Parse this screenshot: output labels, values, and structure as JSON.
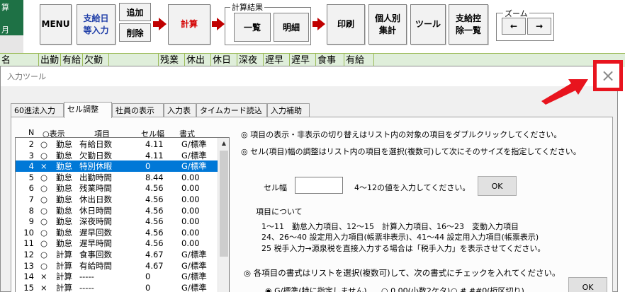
{
  "sheet": {
    "green_tab": [
      "算",
      "",
      "月"
    ],
    "header_cells": [
      "名",
      "出勤",
      "有給",
      "欠勤",
      "",
      "残業",
      "休出",
      "休日",
      "深夜",
      "遅早",
      "遅早",
      "食事",
      "有給"
    ]
  },
  "toolbar": {
    "menu": "MENU",
    "pay_input_l1": "支給日",
    "pay_input_l2": "等入力",
    "add": "追加",
    "delete": "削除",
    "calc": "計算",
    "calc_result_title": "計算結果",
    "list": "一覧",
    "detail": "明細",
    "print": "印刷",
    "individual_l1": "個人別",
    "individual_l2": "集計",
    "tools": "ツール",
    "deduct_l1": "支給控",
    "deduct_l2": "除一覧",
    "zoom_title": "ズーム",
    "zoom_left": "←",
    "zoom_right": "→"
  },
  "dialog": {
    "title": "入力ツール",
    "close": "×",
    "tabs": [
      {
        "label": "60進法入力"
      },
      {
        "label": "セル調整"
      },
      {
        "label": "社員の表示"
      },
      {
        "label": "入力表"
      },
      {
        "label": "タイムカード読込"
      },
      {
        "label": "入力補助"
      }
    ],
    "active_tab": "セル調整",
    "list_headers": {
      "n": "N",
      "display": "○表示",
      "item": "項目",
      "width": "セル幅",
      "format": "書式"
    },
    "rows": [
      {
        "n": "2",
        "mark": "○",
        "cat": "勤怠",
        "name": "有給日数",
        "width": "4.11",
        "fmt": "G/標準"
      },
      {
        "n": "3",
        "mark": "○",
        "cat": "勤怠",
        "name": "欠勤日数",
        "width": "4.11",
        "fmt": "G/標準"
      },
      {
        "n": "4",
        "mark": "×",
        "cat": "勤怠",
        "name": "特別休暇",
        "width": "0",
        "fmt": "G/標準"
      },
      {
        "n": "5",
        "mark": "○",
        "cat": "勤怠",
        "name": "出勤時間",
        "width": "8.44",
        "fmt": "0.00"
      },
      {
        "n": "6",
        "mark": "○",
        "cat": "勤怠",
        "name": "残業時間",
        "width": "4.56",
        "fmt": "0.00"
      },
      {
        "n": "7",
        "mark": "○",
        "cat": "勤怠",
        "name": "休出日数",
        "width": "4.56",
        "fmt": "0.00"
      },
      {
        "n": "8",
        "mark": "○",
        "cat": "勤怠",
        "name": "休日時間",
        "width": "4.56",
        "fmt": "0.00"
      },
      {
        "n": "9",
        "mark": "○",
        "cat": "勤怠",
        "name": "深夜時間",
        "width": "4.56",
        "fmt": "0.00"
      },
      {
        "n": "10",
        "mark": "○",
        "cat": "勤怠",
        "name": "遅早回数",
        "width": "4.56",
        "fmt": "0.00"
      },
      {
        "n": "11",
        "mark": "○",
        "cat": "勤怠",
        "name": "遅早時間",
        "width": "4.56",
        "fmt": "0.00"
      },
      {
        "n": "12",
        "mark": "○",
        "cat": "計算",
        "name": "食事回数",
        "width": "4.67",
        "fmt": "G/標準"
      },
      {
        "n": "13",
        "mark": "○",
        "cat": "計算",
        "name": "有給時間",
        "width": "4.67",
        "fmt": "G/標準"
      },
      {
        "n": "14",
        "mark": "×",
        "cat": "計算",
        "name": "-----",
        "width": "0",
        "fmt": "G/標準"
      },
      {
        "n": "15",
        "mark": "×",
        "cat": "計算",
        "name": "-----",
        "width": "0",
        "fmt": "G/標準"
      }
    ],
    "selected_row": "4",
    "instruction1": "◎ 項目の表示・非表示の切り替えはリスト内の対象の項目をダブルクリックしてください。",
    "instruction2": "◎ セル(項目)幅の調整はリスト内の項目を選択(複数可)して次にそのサイズを指定してください。",
    "cell_width_label": "セル幅",
    "cell_width_value": "",
    "cell_width_hint": "4～12の値を入力してください。",
    "ok": "OK",
    "items_about": "項目について",
    "items_line1": "1～11　勤怠入力項目、12～15　計算入力項目、16～23　変動入力項目",
    "items_line2": "24、26～40 設定用入力項目(帳票非表示)、41～44 設定用入力項目(帳票表示)",
    "items_line3": "25 税手入力→源泉税を直接入力する場合は「税手入力」を表示させてください。",
    "format_instruction": "◎ 各項目の書式はリストを選択(複数可)して、次の書式にチェックを入れてください。",
    "format_options": [
      {
        "label": "G/標準(特に指定しません)",
        "checked": true
      },
      {
        "label": "0.00(小数2ケタ)",
        "checked": false
      },
      {
        "label": "#,##0(桁区切り)",
        "checked": false
      }
    ]
  },
  "colors": {
    "sheet_green": "#1e7145",
    "header_green": "#dfeeda",
    "selection": "#0078d7",
    "callout_red": "#e8141e",
    "calc_red": "#d40000",
    "link_blue": "#1f3ea8"
  }
}
